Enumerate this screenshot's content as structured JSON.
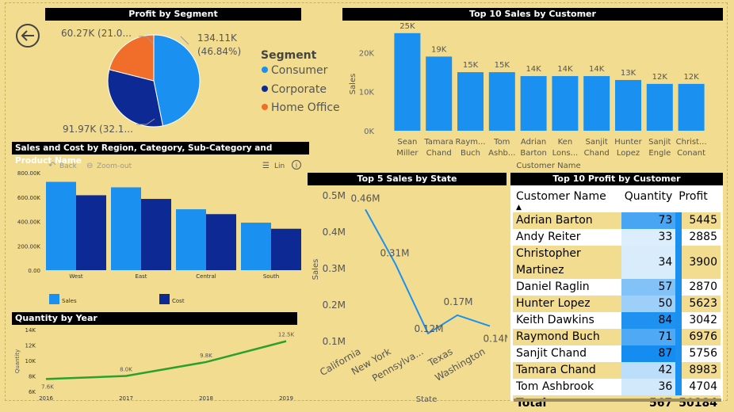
{
  "nav": {
    "back_icon": "arrow-left-icon"
  },
  "segment_chart": {
    "title": "Profit by Segment",
    "legend_title": "Segment",
    "chart_data": {
      "type": "pie",
      "title": "Profit by Segment",
      "slices": [
        {
          "name": "Consumer",
          "value": 134.11,
          "label": "134.11K",
          "pct_label": "(46.84%)",
          "color": "#1a91f0"
        },
        {
          "name": "Corporate",
          "value": 91.97,
          "label": "91.97K (32.1...",
          "color": "#0d2a94"
        },
        {
          "name": "Home Office",
          "value": 60.27,
          "label": "60.27K (21.0...",
          "color": "#f06e2a"
        }
      ]
    }
  },
  "top_customers_chart": {
    "title": "Top 10 Sales by Customer",
    "chart_data": {
      "type": "bar",
      "xlabel": "Customer Name",
      "ylabel": "Sales",
      "ylim": [
        0,
        27000
      ],
      "yticks": [
        "0K",
        "10K",
        "20K"
      ],
      "categories": [
        [
          "Sean",
          "Miller"
        ],
        [
          "Tamara",
          "Chand"
        ],
        [
          "Raym...",
          "Buch"
        ],
        [
          "Tom",
          "Ashb..."
        ],
        [
          "Adrian",
          "Barton"
        ],
        [
          "Ken",
          "Lons..."
        ],
        [
          "Sanjit",
          "Chand"
        ],
        [
          "Hunter",
          "Lopez"
        ],
        [
          "Sanjit",
          "Engle"
        ],
        [
          "Christ...",
          "Conant"
        ]
      ],
      "values": [
        25000,
        19000,
        15000,
        15000,
        14000,
        14000,
        14000,
        13000,
        12000,
        12000
      ],
      "labels": [
        "25K",
        "19K",
        "15K",
        "15K",
        "14K",
        "14K",
        "14K",
        "13K",
        "12K",
        "12K"
      ],
      "color": "#1a91f0"
    }
  },
  "region_chart": {
    "title": "Sales and Cost by Region, Category, Sub-Category and Product Name",
    "toolbar": {
      "back": "Back",
      "zoom_out": "Zoom-out",
      "lin": "Lin",
      "back_icon": "undo-icon",
      "zoom_icon": "zoom-out-icon",
      "lin_icon": "list-icon",
      "info_icon": "info-icon"
    },
    "chart_data": {
      "type": "bar",
      "categories": [
        "West",
        "East",
        "Central",
        "South"
      ],
      "yticks": [
        "0.00",
        "200.00K",
        "400.00K",
        "600.00K",
        "800.00K"
      ],
      "ylim": [
        0,
        800000
      ],
      "series": [
        {
          "name": "Sales",
          "values": [
            725000,
            680000,
            500000,
            390000
          ],
          "color": "#1a91f0"
        },
        {
          "name": "Cost",
          "values": [
            615000,
            585000,
            460000,
            340000
          ],
          "color": "#0d2a94"
        }
      ]
    }
  },
  "state_chart": {
    "title": "Top 5 Sales by State",
    "chart_data": {
      "type": "line",
      "xlabel": "State",
      "ylabel": "Sales",
      "ylim": [
        0.1,
        0.5
      ],
      "yticks": [
        "0.1M",
        "0.2M",
        "0.3M",
        "0.4M",
        "0.5M"
      ],
      "categories": [
        "California",
        "New York",
        "Pennsylva...",
        "Texas",
        "Washington"
      ],
      "values": [
        0.46,
        0.31,
        0.12,
        0.17,
        0.14
      ],
      "labels": [
        "0.46M",
        "0.31M",
        "0.12M",
        "0.17M",
        "0.14M"
      ],
      "color": "#1a91f0"
    }
  },
  "profit_table": {
    "title": "Top 10 Profit by Customer",
    "headers": {
      "name": "Customer Name",
      "quantity": "Quantity",
      "profit": "Profit"
    },
    "sort_icon": "sort-desc-icon",
    "rows": [
      {
        "name": "Adrian Barton",
        "quantity": "73",
        "profit": "5445"
      },
      {
        "name": "Andy Reiter",
        "quantity": "33",
        "profit": "2885"
      },
      {
        "name": "Christopher Martinez",
        "quantity": "34",
        "profit": "3900"
      },
      {
        "name": "Daniel Raglin",
        "quantity": "57",
        "profit": "2870"
      },
      {
        "name": "Hunter Lopez",
        "quantity": "50",
        "profit": "5623"
      },
      {
        "name": "Keith Dawkins",
        "quantity": "84",
        "profit": "3042"
      },
      {
        "name": "Raymond Buch",
        "quantity": "71",
        "profit": "6976"
      },
      {
        "name": "Sanjit Chand",
        "quantity": "87",
        "profit": "5756"
      },
      {
        "name": "Tamara Chand",
        "quantity": "42",
        "profit": "8983"
      },
      {
        "name": "Tom Ashbrook",
        "quantity": "36",
        "profit": "4704"
      }
    ],
    "total": {
      "label": "Total",
      "quantity": "567",
      "profit": "50184"
    }
  },
  "quantity_chart": {
    "title": "Quantity by Year",
    "chart_data": {
      "type": "line",
      "ylabel": "Quantity",
      "ylim": [
        6000,
        14000
      ],
      "yticks": [
        "6K",
        "8K",
        "10K",
        "12K",
        "14K"
      ],
      "categories": [
        "2016",
        "2017",
        "2018",
        "2019"
      ],
      "values": [
        7600,
        8000,
        9800,
        12500
      ],
      "labels": [
        "7.6K",
        "8.0K",
        "9.8K",
        "12.5K"
      ],
      "color": "#2ca02c"
    }
  }
}
